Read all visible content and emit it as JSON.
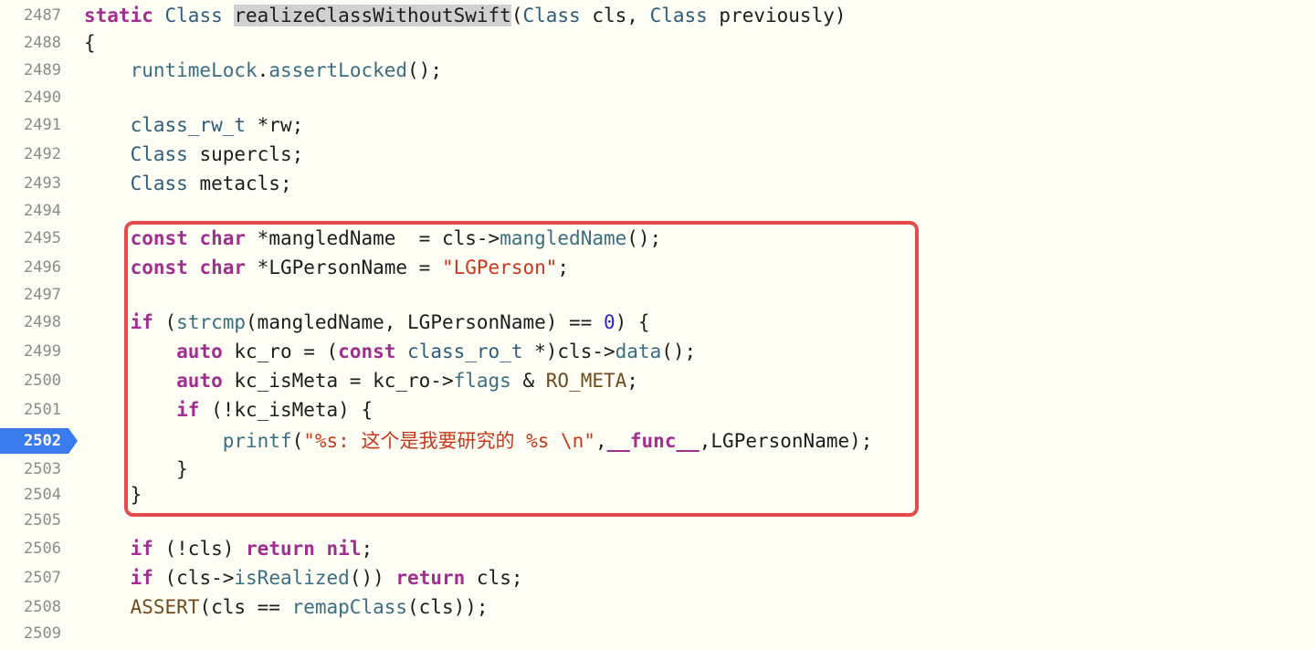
{
  "annotation": {
    "box_color": "#e64b4b",
    "label": "highlighted-region"
  },
  "gutter": {
    "current_line": "2502",
    "current_marker_color": "#3a7bec"
  },
  "lines": [
    {
      "number": "2487",
      "tokens": [
        [
          "kw",
          "static"
        ],
        [
          "plain",
          " "
        ],
        [
          "ty",
          "Class"
        ],
        [
          "plain",
          " "
        ],
        [
          "sel",
          "realizeClassWithoutSwift"
        ],
        [
          "plain",
          "("
        ],
        [
          "ty",
          "Class"
        ],
        [
          "plain",
          " cls, "
        ],
        [
          "ty",
          "Class"
        ],
        [
          "plain",
          " previously)"
        ]
      ]
    },
    {
      "number": "2488",
      "tokens": [
        [
          "plain",
          "{"
        ]
      ]
    },
    {
      "number": "2489",
      "tokens": [
        [
          "plain",
          "    "
        ],
        [
          "fn",
          "runtimeLock"
        ],
        [
          "plain",
          "."
        ],
        [
          "fn",
          "assertLocked"
        ],
        [
          "plain",
          "();"
        ]
      ]
    },
    {
      "number": "2490",
      "tokens": []
    },
    {
      "number": "2491",
      "tokens": [
        [
          "plain",
          "    "
        ],
        [
          "ty",
          "class_rw_t"
        ],
        [
          "plain",
          " *rw;"
        ]
      ]
    },
    {
      "number": "2492",
      "tokens": [
        [
          "plain",
          "    "
        ],
        [
          "ty",
          "Class"
        ],
        [
          "plain",
          " supercls;"
        ]
      ]
    },
    {
      "number": "2493",
      "tokens": [
        [
          "plain",
          "    "
        ],
        [
          "ty",
          "Class"
        ],
        [
          "plain",
          " metacls;"
        ]
      ]
    },
    {
      "number": "2494",
      "tokens": []
    },
    {
      "number": "2495",
      "tokens": [
        [
          "plain",
          "    "
        ],
        [
          "kw",
          "const"
        ],
        [
          "plain",
          " "
        ],
        [
          "kw",
          "char"
        ],
        [
          "plain",
          " *mangledName  = cls->"
        ],
        [
          "fn",
          "mangledName"
        ],
        [
          "plain",
          "();"
        ]
      ]
    },
    {
      "number": "2496",
      "tokens": [
        [
          "plain",
          "    "
        ],
        [
          "kw",
          "const"
        ],
        [
          "plain",
          " "
        ],
        [
          "kw",
          "char"
        ],
        [
          "plain",
          " *LGPersonName = "
        ],
        [
          "str",
          "\"LGPerson\""
        ],
        [
          "plain",
          ";"
        ]
      ]
    },
    {
      "number": "2497",
      "tokens": []
    },
    {
      "number": "2498",
      "tokens": [
        [
          "plain",
          "    "
        ],
        [
          "kw",
          "if"
        ],
        [
          "plain",
          " ("
        ],
        [
          "fn",
          "strcmp"
        ],
        [
          "plain",
          "(mangledName, LGPersonName) == "
        ],
        [
          "num",
          "0"
        ],
        [
          "plain",
          ") {"
        ]
      ]
    },
    {
      "number": "2499",
      "tokens": [
        [
          "plain",
          "        "
        ],
        [
          "kw",
          "auto"
        ],
        [
          "plain",
          " kc_ro = ("
        ],
        [
          "kw",
          "const"
        ],
        [
          "plain",
          " "
        ],
        [
          "ty",
          "class_ro_t"
        ],
        [
          "plain",
          " *)cls->"
        ],
        [
          "fn",
          "data"
        ],
        [
          "plain",
          "();"
        ]
      ]
    },
    {
      "number": "2500",
      "tokens": [
        [
          "plain",
          "        "
        ],
        [
          "kw",
          "auto"
        ],
        [
          "plain",
          " kc_isMeta = kc_ro->"
        ],
        [
          "fn",
          "flags"
        ],
        [
          "plain",
          " & "
        ],
        [
          "mac",
          "RO_META"
        ],
        [
          "plain",
          ";"
        ]
      ]
    },
    {
      "number": "2501",
      "tokens": [
        [
          "plain",
          "        "
        ],
        [
          "kw",
          "if"
        ],
        [
          "plain",
          " (!kc_isMeta) {"
        ]
      ]
    },
    {
      "number": "2502",
      "tokens": [
        [
          "plain",
          "            "
        ],
        [
          "fn",
          "printf"
        ],
        [
          "plain",
          "("
        ],
        [
          "str",
          "\"%s: 这个是我要研究的 %s \\n\""
        ],
        [
          "plain",
          ","
        ],
        [
          "kw",
          "__func__"
        ],
        [
          "plain",
          ",LGPersonName);"
        ]
      ]
    },
    {
      "number": "2503",
      "tokens": [
        [
          "plain",
          "        }"
        ]
      ]
    },
    {
      "number": "2504",
      "tokens": [
        [
          "plain",
          "    }"
        ]
      ]
    },
    {
      "number": "2505",
      "tokens": []
    },
    {
      "number": "2506",
      "tokens": [
        [
          "plain",
          "    "
        ],
        [
          "kw",
          "if"
        ],
        [
          "plain",
          " (!cls) "
        ],
        [
          "kw",
          "return"
        ],
        [
          "plain",
          " "
        ],
        [
          "kw",
          "nil"
        ],
        [
          "plain",
          ";"
        ]
      ]
    },
    {
      "number": "2507",
      "tokens": [
        [
          "plain",
          "    "
        ],
        [
          "kw",
          "if"
        ],
        [
          "plain",
          " (cls->"
        ],
        [
          "fn",
          "isRealized"
        ],
        [
          "plain",
          "()) "
        ],
        [
          "kw",
          "return"
        ],
        [
          "plain",
          " cls;"
        ]
      ]
    },
    {
      "number": "2508",
      "tokens": [
        [
          "plain",
          "    "
        ],
        [
          "mac",
          "ASSERT"
        ],
        [
          "plain",
          "(cls == "
        ],
        [
          "fn",
          "remapClass"
        ],
        [
          "plain",
          "(cls));"
        ]
      ]
    },
    {
      "number": "2509",
      "tokens": []
    }
  ]
}
